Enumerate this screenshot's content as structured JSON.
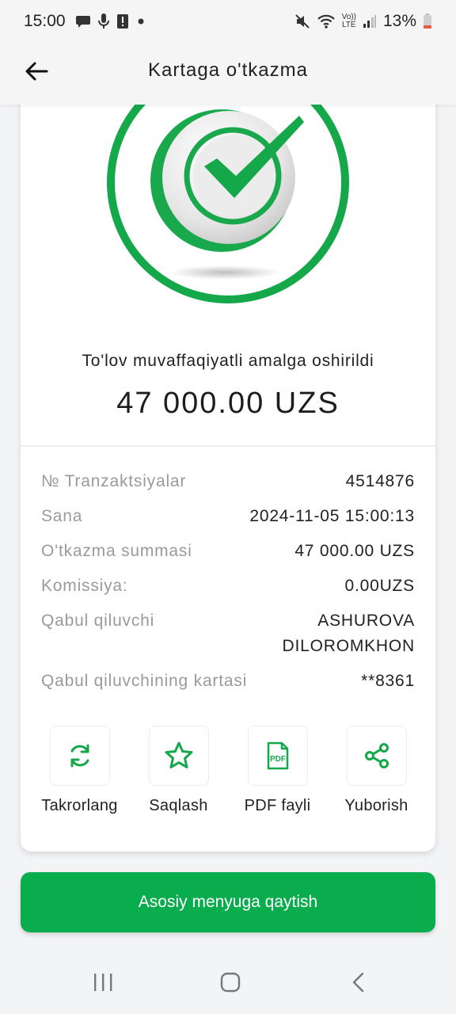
{
  "status_bar": {
    "time": "15:00",
    "battery": "13%",
    "volte_label_top": "Vo))",
    "volte_label_bottom": "LTE",
    "icons_left": [
      "chat-icon",
      "mic-icon",
      "alert-icon",
      "dot-icon"
    ],
    "icons_right": [
      "mute-icon",
      "wifi-icon",
      "volte-icon",
      "signal-icon",
      "battery-icon"
    ]
  },
  "app_bar": {
    "title": "Kartaga o'tkazma"
  },
  "receipt": {
    "success_message": "To'lov muvaffaqiyatli amalga oshirildi",
    "amount": "47 000.00 UZS",
    "details": [
      {
        "label": "№ Tranzaktsiyalar",
        "value": "4514876"
      },
      {
        "label": "Sana",
        "value": "2024-11-05 15:00:13"
      },
      {
        "label": "O'tkazma summasi",
        "value": "47 000.00 UZS"
      },
      {
        "label": "Komissiya:",
        "value": "0.00UZS"
      },
      {
        "label": "Qabul qiluvchi",
        "value_line1": "ASHUROVA",
        "value_line2": "DILOROMKHON"
      },
      {
        "label": "Qabul qiluvchining kartasi",
        "value": "**8361"
      }
    ],
    "actions": [
      {
        "label": "Takrorlang",
        "icon": "repeat-icon"
      },
      {
        "label": "Saqlash",
        "icon": "star-icon"
      },
      {
        "label": "PDF fayli",
        "icon": "pdf-icon",
        "icon_text": "PDF"
      },
      {
        "label": "Yuborish",
        "icon": "share-icon"
      }
    ]
  },
  "home_button": {
    "label": "Asosiy menyuga qaytish"
  },
  "colors": {
    "accent": "#0aad4e",
    "text_primary": "#222222",
    "text_secondary": "#9a9a9a"
  },
  "nav_bar": [
    "recent-apps-icon",
    "home-icon",
    "back-icon"
  ]
}
